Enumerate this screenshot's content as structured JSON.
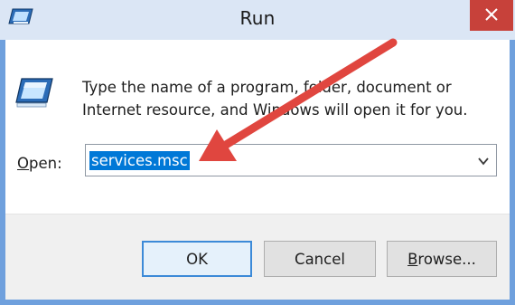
{
  "window": {
    "title": "Run"
  },
  "dialog": {
    "description_line1": "Type the name of a program, folder, document or",
    "description_line2": "Internet resource, and Windows will open it for you.",
    "open_label_prefix": "",
    "open_label_access_key": "O",
    "open_label_rest": "pen:",
    "open_value": "services.msc"
  },
  "buttons": {
    "ok_label": "OK",
    "cancel_label": "Cancel",
    "browse_access_key": "B",
    "browse_rest": "rowse..."
  },
  "icons": {
    "app": "run-app-icon",
    "dialog": "run-dialog-icon",
    "close": "close-icon",
    "dropdown": "chevron-down-icon",
    "annotation": "red-arrow-annotation"
  },
  "colors": {
    "close_button": "#c7413a",
    "selection": "#0078d7",
    "annotation_arrow": "#e0463f",
    "default_button_border": "#3c8ad8"
  }
}
